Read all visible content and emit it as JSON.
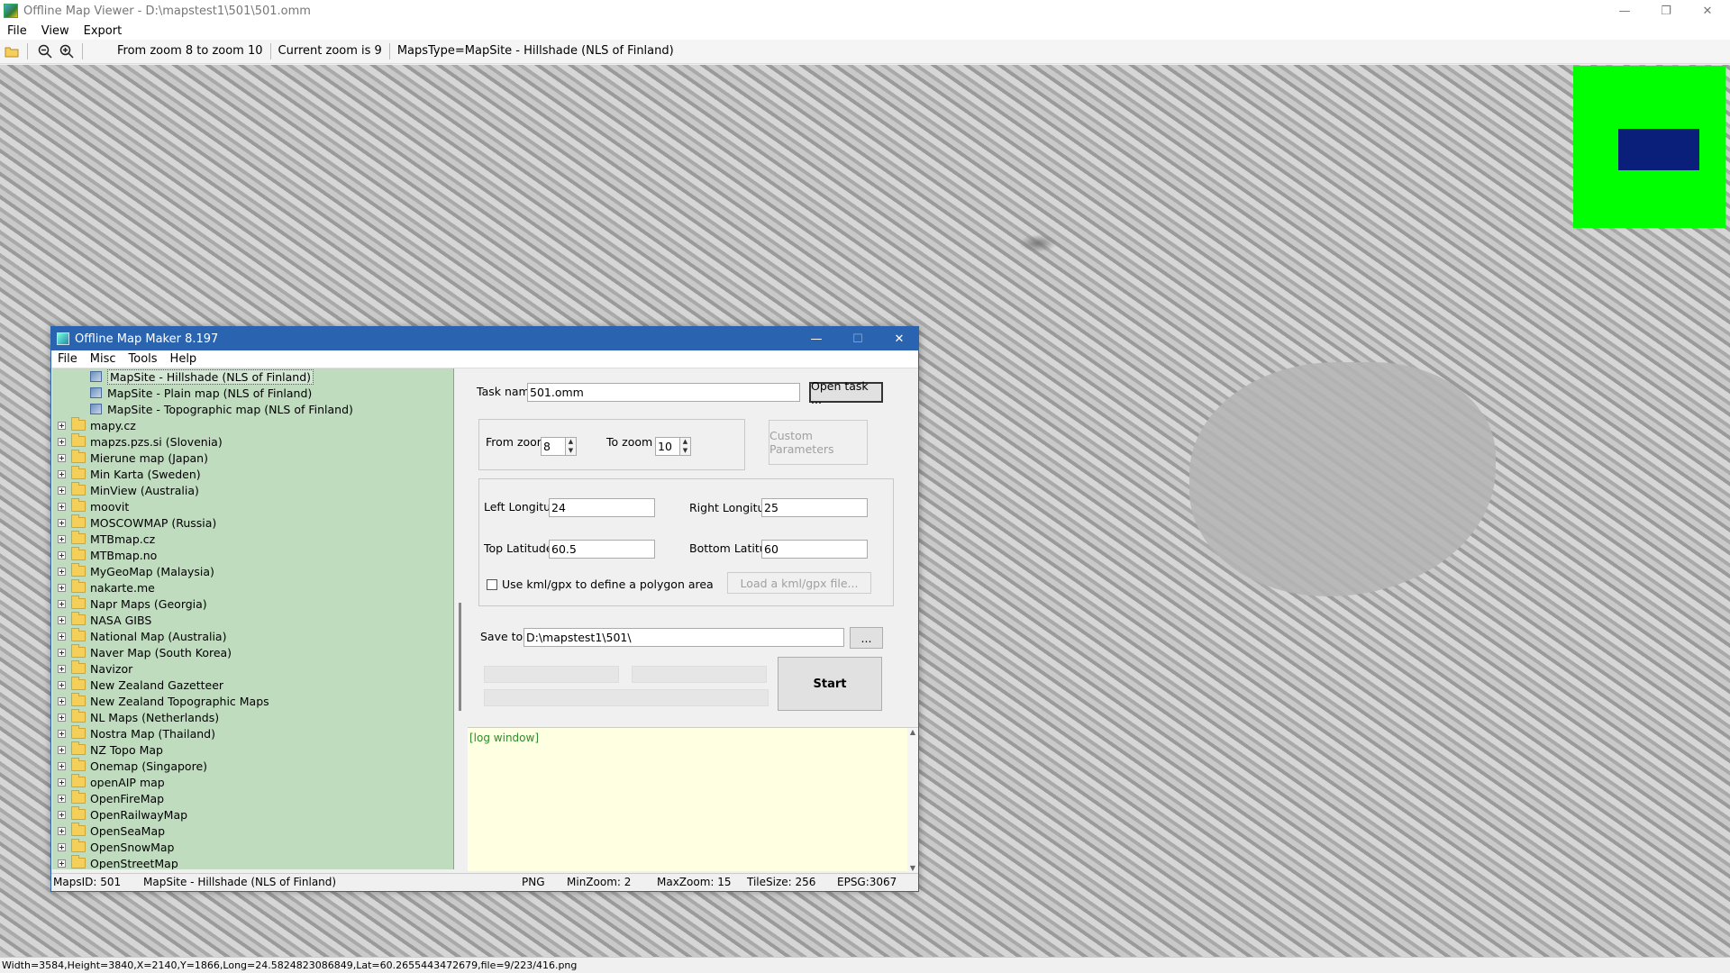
{
  "window": {
    "title": "Offline Map Viewer - D:\\mapstest1\\501\\501.omm"
  },
  "menu": [
    "File",
    "View",
    "Export"
  ],
  "toolbar": {
    "zoom_range": "From zoom 8 to zoom 10",
    "current_zoom": "Current zoom is 9",
    "maps_type": "MapsType=MapSite - Hillshade (NLS of Finland)"
  },
  "status": "Width=3584,Height=3840,X=2140,Y=1866,Long=24.5824823086849,Lat=60.2655443472679,file=9/223/416.png",
  "colors": {
    "overview_bg": "#00ff00",
    "overview_viewport": "#0a1f7a",
    "dialog_titlebar": "#2a64b0",
    "tree_bg": "#bfdcbf",
    "log_bg": "#ffffe1"
  },
  "dialog": {
    "title": "Offline Map Maker 8.197",
    "menu": [
      "File",
      "Misc",
      "Tools",
      "Help"
    ],
    "tree_children": [
      "MapSite - Hillshade (NLS of Finland)",
      "MapSite - Plain map (NLS of Finland)",
      "MapSite - Topographic map (NLS of Finland)"
    ],
    "tree_folders": [
      "mapy.cz",
      "mapzs.pzs.si (Slovenia)",
      "Mierune map (Japan)",
      "Min Karta (Sweden)",
      "MinView (Australia)",
      "moovit",
      "MOSCOWMAP (Russia)",
      "MTBmap.cz",
      "MTBmap.no",
      "MyGeoMap (Malaysia)",
      "nakarte.me",
      "Napr Maps (Georgia)",
      "NASA GIBS",
      "National Map (Australia)",
      "Naver Map (South Korea)",
      "Navizor",
      "New Zealand Gazetteer",
      "New Zealand Topographic Maps",
      "NL Maps (Netherlands)",
      "Nostra Map (Thailand)",
      "NZ Topo Map",
      "Onemap (Singapore)",
      "openAIP map",
      "OpenFireMap",
      "OpenRailwayMap",
      "OpenSeaMap",
      "OpenSnowMap",
      "OpenStreetMap"
    ],
    "task_name_label": "Task name",
    "task_name_value": "501.omm",
    "open_task_label": "Open task ...",
    "from_zoom_label": "From zoom",
    "from_zoom_value": "8",
    "to_zoom_label": "To zoom",
    "to_zoom_value": "10",
    "custom_params_label": "Custom Parameters",
    "left_lon_label": "Left Longitude",
    "left_lon_value": "24",
    "right_lon_label": "Right Longitude",
    "right_lon_value": "25",
    "top_lat_label": "Top Latitude",
    "top_lat_value": "60.5",
    "bottom_lat_label": "Bottom Latitude",
    "bottom_lat_value": "60",
    "kml_checkbox_label": "Use kml/gpx to define a polygon area",
    "load_kml_label": "Load a kml/gpx file...",
    "save_to_label": "Save to:",
    "save_to_value": "D:\\mapstest1\\501\\",
    "browse_label": "...",
    "start_label": "Start",
    "log_text": "[log window]",
    "status": {
      "maps_id": "MapsID: 501",
      "map_name": "MapSite - Hillshade (NLS of Finland)",
      "format": "PNG",
      "min_zoom": "MinZoom: 2",
      "max_zoom": "MaxZoom: 15",
      "tile_size": "TileSize: 256",
      "epsg": "EPSG:3067"
    }
  }
}
